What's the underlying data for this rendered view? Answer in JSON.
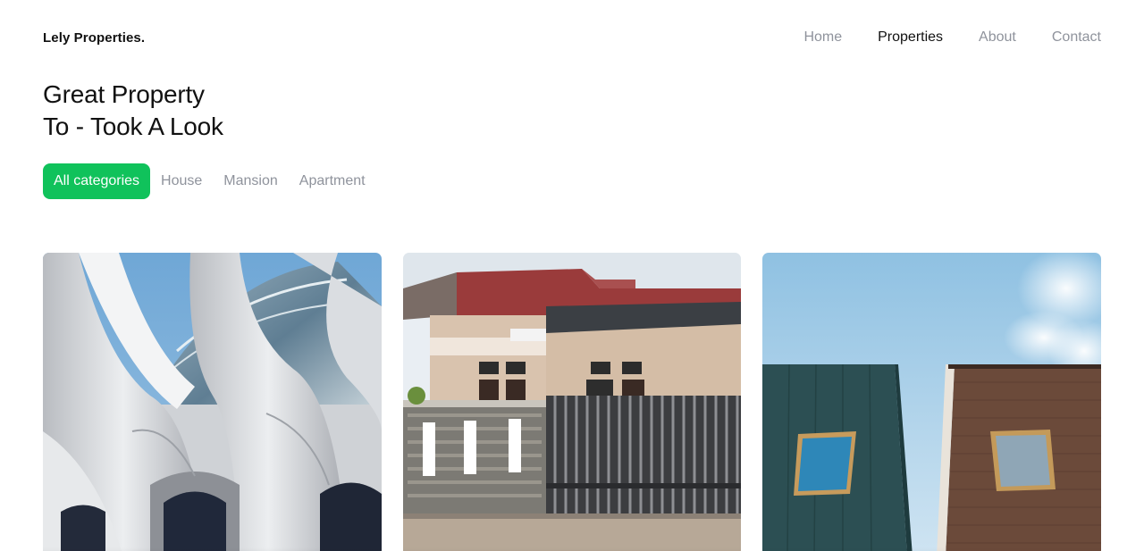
{
  "brand": {
    "name": "Lely Properties."
  },
  "nav": {
    "items": [
      {
        "label": "Home",
        "active": false
      },
      {
        "label": "Properties",
        "active": true
      },
      {
        "label": "About",
        "active": false
      },
      {
        "label": "Contact",
        "active": false
      }
    ]
  },
  "hero": {
    "line1": "Great Property",
    "line2": "To - Took A Look"
  },
  "filters": {
    "items": [
      {
        "label": "All categories",
        "active": true
      },
      {
        "label": "House",
        "active": false
      },
      {
        "label": "Mansion",
        "active": false
      },
      {
        "label": "Apartment",
        "active": false
      }
    ]
  },
  "colors": {
    "accent": "#10c25b",
    "muted_text": "#8f939c",
    "text": "#111111"
  }
}
